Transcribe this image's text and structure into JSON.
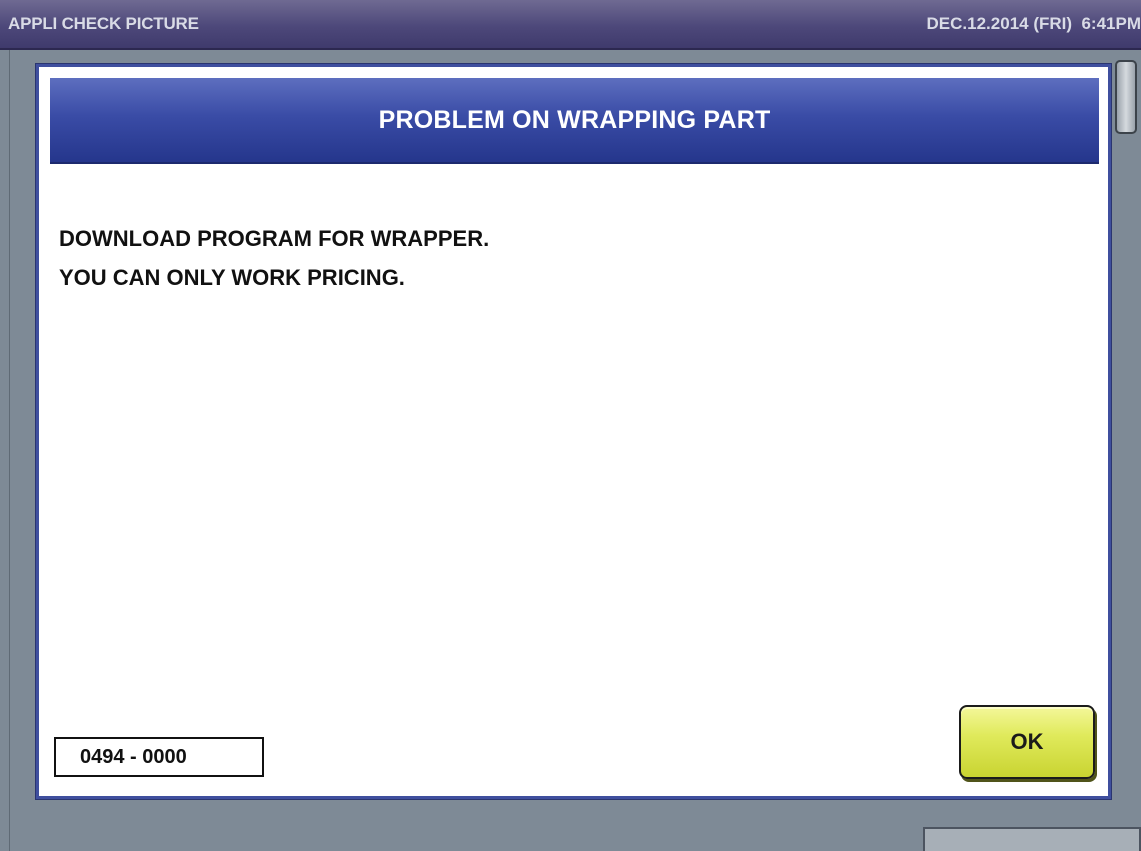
{
  "titlebar": {
    "app_title": "APPLI CHECK PICTURE",
    "datetime": "DEC.12.2014 (FRI)  6:41PM"
  },
  "dialog": {
    "title": "PROBLEM ON WRAPPING PART",
    "message_lines": [
      "DOWNLOAD PROGRAM FOR WRAPPER.",
      "YOU CAN ONLY WORK PRICING."
    ],
    "error_code": "0494 - 0000",
    "ok_label": "OK"
  },
  "colors": {
    "titlebar": "#4d487a",
    "dialog_header": "#3a4ca6",
    "ok_button": "#e0ea5c",
    "background": "#7e8a96"
  }
}
